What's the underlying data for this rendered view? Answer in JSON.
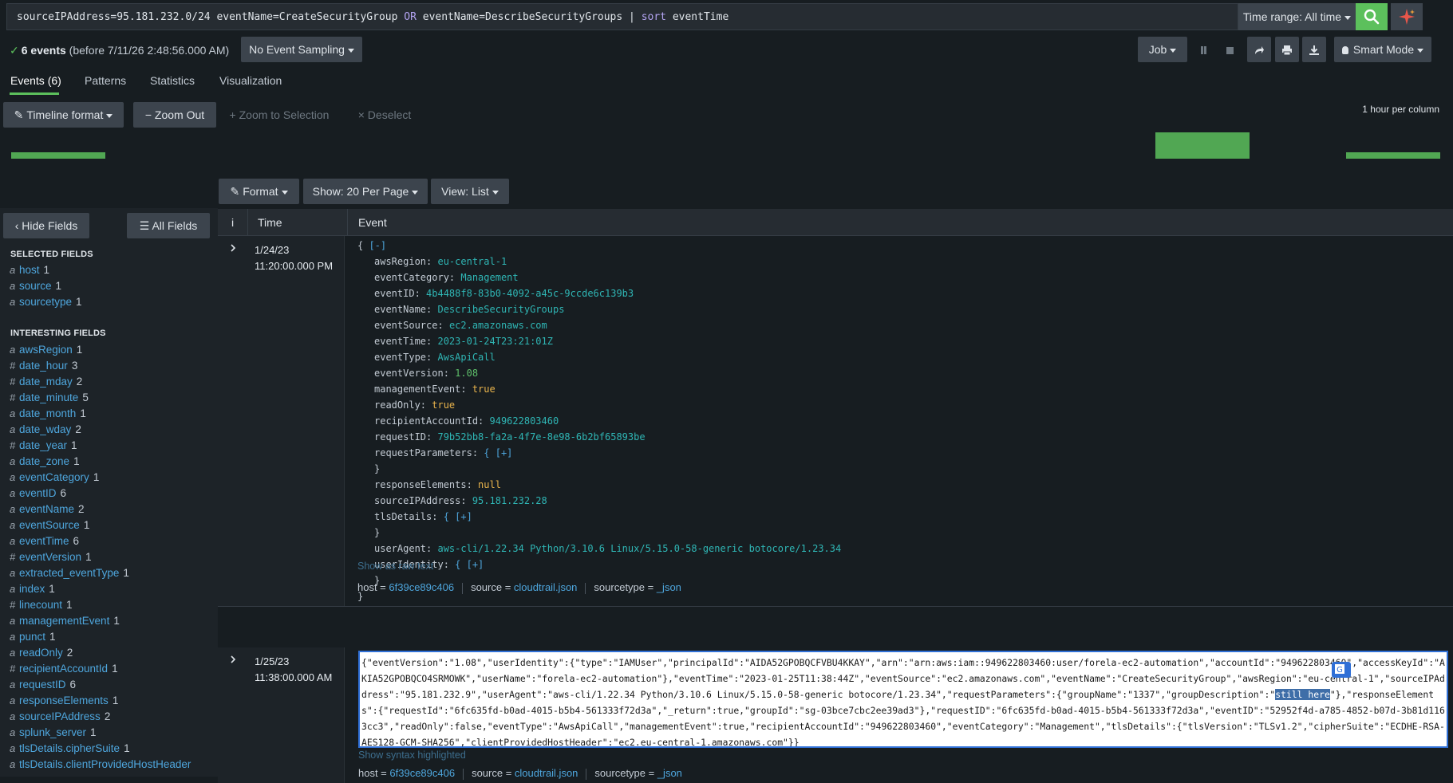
{
  "search": {
    "query_part1": "sourceIPAddress=95.181.232.0/24 eventName=CreateSecurityGroup ",
    "query_or": "OR",
    "query_part2": " eventName=DescribeSecurityGroups | ",
    "query_sort": "sort",
    "query_part3": " eventTime",
    "time_range_label": "Time range: All time"
  },
  "status": {
    "event_count": "6 events",
    "event_suffix": " (before 7/11/26 2:48:56.000 AM)",
    "sampling_label": "No Event Sampling",
    "job_label": "Job",
    "mode_label": "Smart Mode"
  },
  "tabs": [
    {
      "label": "Events (6)"
    },
    {
      "label": "Patterns"
    },
    {
      "label": "Statistics"
    },
    {
      "label": "Visualization"
    }
  ],
  "timeline": {
    "format_label": "Timeline format",
    "zoom_out_label": "Zoom Out",
    "zoom_selection_label": "Zoom to Selection",
    "deselect_label": "Deselect",
    "scale_label": "1 hour per column"
  },
  "results_toolbar": {
    "format_label": "Format",
    "per_page_label": "Show: 20 Per Page",
    "view_label": "View: List"
  },
  "sidebar": {
    "hide_fields_label": "Hide Fields",
    "all_fields_label": "All Fields",
    "selected_heading": "SELECTED FIELDS",
    "interesting_heading": "INTERESTING FIELDS",
    "selected": [
      {
        "type": "a",
        "name": "host",
        "count": "1"
      },
      {
        "type": "a",
        "name": "source",
        "count": "1"
      },
      {
        "type": "a",
        "name": "sourcetype",
        "count": "1"
      }
    ],
    "interesting": [
      {
        "type": "a",
        "name": "awsRegion",
        "count": "1"
      },
      {
        "type": "#",
        "name": "date_hour",
        "count": "3"
      },
      {
        "type": "#",
        "name": "date_mday",
        "count": "2"
      },
      {
        "type": "#",
        "name": "date_minute",
        "count": "5"
      },
      {
        "type": "a",
        "name": "date_month",
        "count": "1"
      },
      {
        "type": "a",
        "name": "date_wday",
        "count": "2"
      },
      {
        "type": "#",
        "name": "date_year",
        "count": "1"
      },
      {
        "type": "a",
        "name": "date_zone",
        "count": "1"
      },
      {
        "type": "a",
        "name": "eventCategory",
        "count": "1"
      },
      {
        "type": "a",
        "name": "eventID",
        "count": "6"
      },
      {
        "type": "a",
        "name": "eventName",
        "count": "2"
      },
      {
        "type": "a",
        "name": "eventSource",
        "count": "1"
      },
      {
        "type": "a",
        "name": "eventTime",
        "count": "6"
      },
      {
        "type": "#",
        "name": "eventVersion",
        "count": "1"
      },
      {
        "type": "a",
        "name": "extracted_eventType",
        "count": "1"
      },
      {
        "type": "a",
        "name": "index",
        "count": "1"
      },
      {
        "type": "#",
        "name": "linecount",
        "count": "1"
      },
      {
        "type": "a",
        "name": "managementEvent",
        "count": "1"
      },
      {
        "type": "a",
        "name": "punct",
        "count": "1"
      },
      {
        "type": "a",
        "name": "readOnly",
        "count": "2"
      },
      {
        "type": "#",
        "name": "recipientAccountId",
        "count": "1"
      },
      {
        "type": "a",
        "name": "requestID",
        "count": "6"
      },
      {
        "type": "a",
        "name": "responseElements",
        "count": "1"
      },
      {
        "type": "a",
        "name": "sourceIPAddress",
        "count": "2"
      },
      {
        "type": "a",
        "name": "splunk_server",
        "count": "1"
      },
      {
        "type": "a",
        "name": "tlsDetails.cipherSuite",
        "count": "1"
      },
      {
        "type": "a",
        "name": "tlsDetails.clientProvidedHostHeader",
        "count": ""
      }
    ]
  },
  "table": {
    "col_info": "i",
    "col_time": "Time",
    "col_event": "Event"
  },
  "events": [
    {
      "date": "1/24/23",
      "time": "11:20:00.000 PM",
      "collapse": "[-]",
      "fields": [
        {
          "key": "awsRegion",
          "value": "eu-central-1",
          "kind": "str"
        },
        {
          "key": "eventCategory",
          "value": "Management",
          "kind": "str"
        },
        {
          "key": "eventID",
          "value": "4b4488f8-83b0-4092-a45c-9ccde6c139b3",
          "kind": "str"
        },
        {
          "key": "eventName",
          "value": "DescribeSecurityGroups",
          "kind": "str"
        },
        {
          "key": "eventSource",
          "value": "ec2.amazonaws.com",
          "kind": "str"
        },
        {
          "key": "eventTime",
          "value": "2023-01-24T23:21:01Z",
          "kind": "str"
        },
        {
          "key": "eventType",
          "value": "AwsApiCall",
          "kind": "str"
        },
        {
          "key": "eventVersion",
          "value": "1.08",
          "kind": "num"
        },
        {
          "key": "managementEvent",
          "value": "true",
          "kind": "bool"
        },
        {
          "key": "readOnly",
          "value": "true",
          "kind": "bool"
        },
        {
          "key": "recipientAccountId",
          "value": "949622803460",
          "kind": "str"
        },
        {
          "key": "requestID",
          "value": "79b52bb8-fa2a-4f7e-8e98-6b2bf65893be",
          "kind": "str"
        },
        {
          "key": "requestParameters",
          "value": "{ [+]",
          "kind": "obj"
        },
        {
          "key": "",
          "value": "}",
          "kind": "close"
        },
        {
          "key": "responseElements",
          "value": "null",
          "kind": "bool"
        },
        {
          "key": "sourceIPAddress",
          "value": "95.181.232.28",
          "kind": "str"
        },
        {
          "key": "tlsDetails",
          "value": "{ [+]",
          "kind": "obj"
        },
        {
          "key": "",
          "value": "}",
          "kind": "close"
        },
        {
          "key": "userAgent",
          "value": "aws-cli/1.22.34 Python/3.10.6 Linux/5.15.0-58-generic botocore/1.23.34",
          "kind": "str"
        },
        {
          "key": "userIdentity",
          "value": "{ [+]",
          "kind": "obj"
        },
        {
          "key": "",
          "value": "}",
          "kind": "close"
        }
      ],
      "raw_link": "Show as raw text",
      "host_label": "host = ",
      "host": "6f39ce89c406",
      "source_label": "source = ",
      "source": "cloudtrail.json",
      "sourcetype_label": "sourcetype = ",
      "sourcetype": "_json"
    },
    {
      "date": "1/25/23",
      "time": "11:38:00.000 AM",
      "raw_before": "{\"eventVersion\":\"1.08\",\"userIdentity\":{\"type\":\"IAMUser\",\"principalId\":\"AIDA52GPOBQCFVBU4KKAY\",\"arn\":\"arn:aws:iam::949622803460:user/forela-ec2-automation\",\"accountId\":\"949622803460\",\"accessKeyId\":\"AKIA52GPOBQCO4SRMOWK\",\"userName\":\"forela-ec2-automation\"},\"eventTime\":\"2023-01-25T11:38:44Z\",\"eventSource\":\"ec2.amazonaws.com\",\"eventName\":\"CreateSecurityGroup\",\"awsRegion\":\"eu-central-1\",\"sourceIPAddress\":\"95.181.232.9\",\"userAgent\":\"aws-cli/1.22.34 Python/3.10.6 Linux/5.15.0-58-generic botocore/1.23.34\",\"requestParameters\":{\"groupName\":\"1337\",\"groupDescription\":\"",
      "raw_highlight": "still here",
      "raw_after": "\"},\"responseElements\":{\"requestId\":\"6fc635fd-b0ad-4015-b5b4-561333f72d3a\",\"_return\":true,\"groupId\":\"sg-03bce7cbc2ee39ad3\"},\"requestID\":\"6fc635fd-b0ad-4015-b5b4-561333f72d3a\",\"eventID\":\"52952f4d-a785-4852-b07d-3b81d1163cc3\",\"readOnly\":false,\"eventType\":\"AwsApiCall\",\"managementEvent\":true,\"recipientAccountId\":\"949622803460\",\"eventCategory\":\"Management\",\"tlsDetails\":{\"tlsVersion\":\"TLSv1.2\",\"cipherSuite\":\"ECDHE-RSA-AES128-GCM-SHA256\",\"clientProvidedHostHeader\":\"ec2.eu-central-1.amazonaws.com\"}}",
      "raw_link": "Show syntax highlighted",
      "host_label": "host = ",
      "host": "6f39ce89c406",
      "source_label": "source = ",
      "source": "cloudtrail.json",
      "sourcetype_label": "sourcetype = ",
      "sourcetype": "_json"
    }
  ],
  "colors": {
    "accent": "#5cc05c",
    "link": "#4ea6dd",
    "json_value": "#2fb6b5",
    "background": "#171d21"
  }
}
